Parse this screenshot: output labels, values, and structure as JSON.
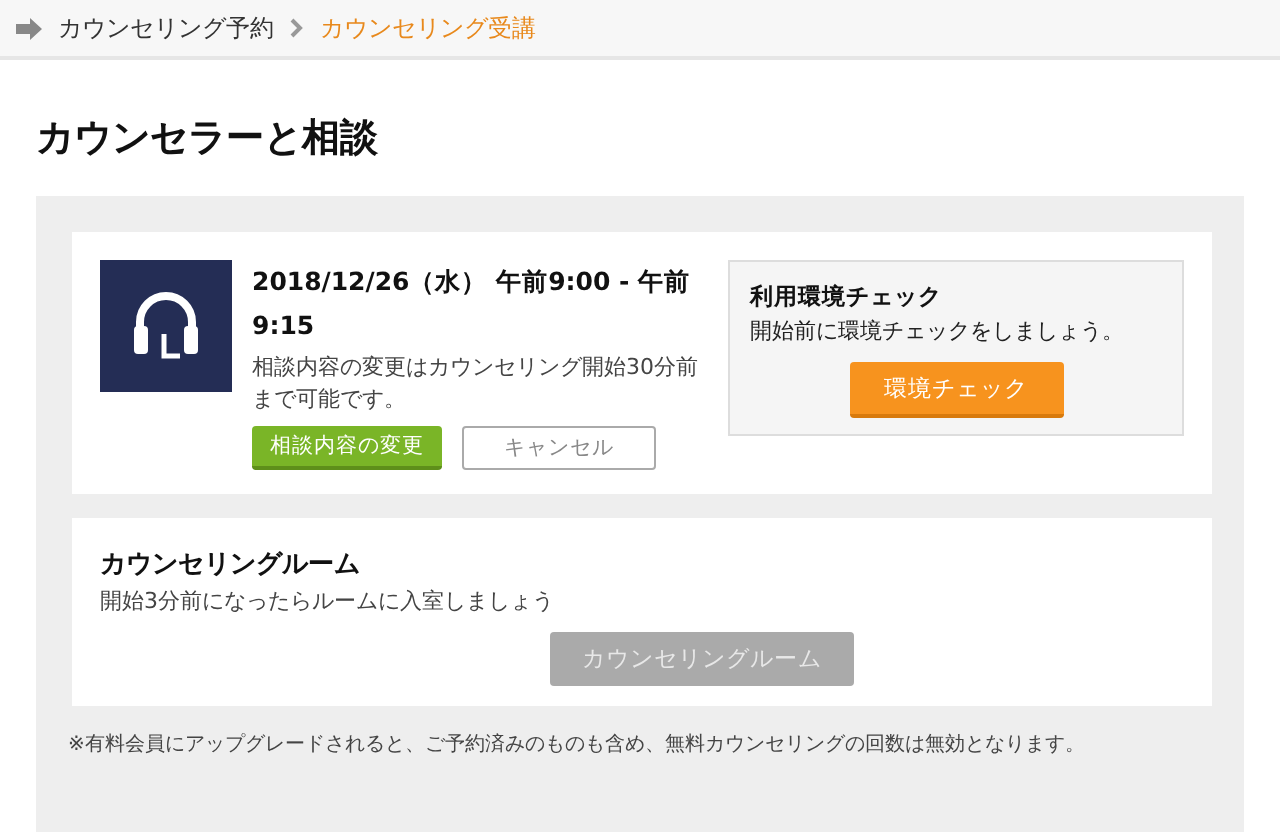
{
  "breadcrumb": [
    {
      "label": "カウンセリング予約",
      "selected": false
    },
    {
      "label": "カウンセリング受講",
      "selected": true
    }
  ],
  "title": "カウンセラーと相談",
  "appointment": {
    "datetime": "2018/12/26（水） 午前9:00 - 午前9:15",
    "note": "相談内容の変更はカウンセリング開始30分前まで可能です。",
    "buttons": [
      {
        "label": "相談内容の変更",
        "kind": "primary"
      },
      {
        "label": "キャンセル",
        "kind": "outline"
      }
    ]
  },
  "env_check": {
    "title": "利用環境チェック",
    "text": "開始前に環境チェックをしましょう。",
    "button": "環境チェック"
  },
  "room": {
    "title": "カウンセリングルーム",
    "text": "開始3分前になったらルームに入室しましょう",
    "button": {
      "label": "カウンセリングルーム",
      "disabled": true
    }
  },
  "footnote": "※有料会員にアップグレードされると、ご予約済みのものも含め、無料カウンセリングの回数は無効となります。"
}
